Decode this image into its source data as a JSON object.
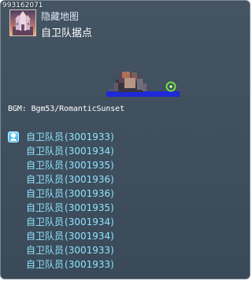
{
  "map": {
    "id": "993162071",
    "hidden_label": "隐藏地图",
    "name": "自卫队据点",
    "bgm": "BGM: Bgm53/RomanticSunset"
  },
  "npcs": [
    {
      "name": "自卫队员",
      "id": "(3001933)"
    },
    {
      "name": "自卫队员",
      "id": "(3001934)"
    },
    {
      "name": "自卫队员",
      "id": "(3001935)"
    },
    {
      "name": "自卫队员",
      "id": "(3001936)"
    },
    {
      "name": "自卫队员",
      "id": "(3001936)"
    },
    {
      "name": "自卫队员",
      "id": "(3001935)"
    },
    {
      "name": "自卫队员",
      "id": "(3001934)"
    },
    {
      "name": "自卫队员",
      "id": "(3001934)"
    },
    {
      "name": "自卫队员",
      "id": "(3001933)"
    },
    {
      "name": "自卫队员",
      "id": "(3001933)"
    }
  ],
  "icons": {
    "thumbnail": "castle-thumbnail-icon",
    "portal": "green-portal-icon",
    "npc": "npc-person-icon"
  },
  "colors": {
    "panel_background": "#445463",
    "npc_text": "#8ee4ff",
    "portal": "#6fdc4b"
  }
}
